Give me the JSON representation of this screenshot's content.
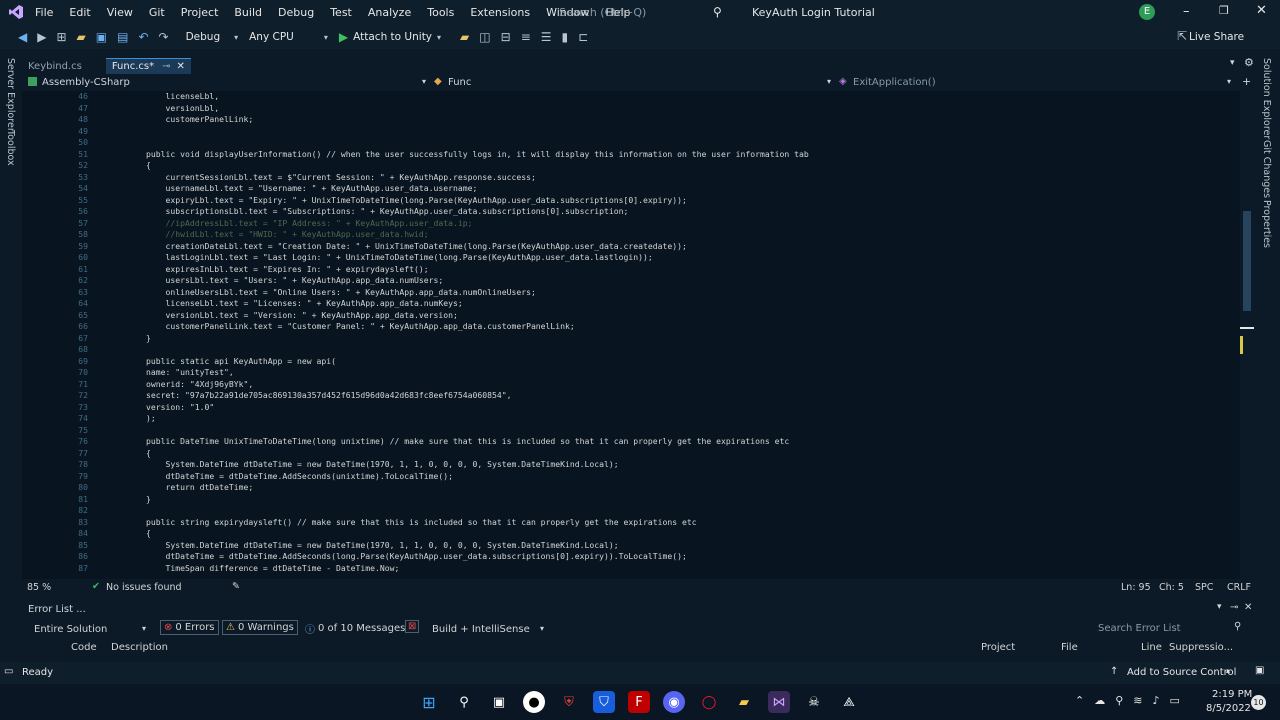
{
  "menu": [
    "File",
    "Edit",
    "View",
    "Git",
    "Project",
    "Build",
    "Debug",
    "Test",
    "Analyze",
    "Tools",
    "Extensions",
    "Window",
    "Help"
  ],
  "search_placeholder": "Search (Ctrl+Q)",
  "window_title": "KeyAuth Login Tutorial",
  "account_initial": "E",
  "toolbar": {
    "config": "Debug",
    "platform": "Any CPU",
    "attach": "Attach to Unity",
    "live_share": "Live Share"
  },
  "tabs": [
    {
      "label": "Keybind.cs"
    },
    {
      "label": "Func.cs*"
    }
  ],
  "nav": {
    "project": "Assembly-CSharp",
    "type": "Func",
    "member": "ExitApplication()"
  },
  "left_side": [
    "Server Explorer",
    "Toolbox"
  ],
  "right_side": [
    "Solution Explorer",
    "Git Changes",
    "Properties"
  ],
  "code_lines": [
    {
      "n": "46",
      "t": "            licenseLbl,"
    },
    {
      "n": "47",
      "t": "            versionLbl,"
    },
    {
      "n": "48",
      "t": "            customerPanelLink;"
    },
    {
      "n": "49",
      "t": ""
    },
    {
      "n": "50",
      "t": ""
    },
    {
      "n": "51",
      "t": "        public void displayUserInformation() // when the user successfully logs in, it will display this information on the user information tab"
    },
    {
      "n": "52",
      "t": "        {"
    },
    {
      "n": "53",
      "t": "            currentSessionLbl.text = $\"Current Session: \" + KeyAuthApp.response.success;"
    },
    {
      "n": "54",
      "t": "            usernameLbl.text = \"Username: \" + KeyAuthApp.user_data.username;"
    },
    {
      "n": "55",
      "t": "            expiryLbl.text = \"Expiry: \" + UnixTimeToDateTime(long.Parse(KeyAuthApp.user_data.subscriptions[0].expiry));"
    },
    {
      "n": "56",
      "t": "            subscriptionsLbl.text = \"Subscriptions: \" + KeyAuthApp.user_data.subscriptions[0].subscription;"
    },
    {
      "n": "57",
      "t": "            //ipAddressLbl.text = \"IP Address: \" + KeyAuthApp.user_data.ip;"
    },
    {
      "n": "58",
      "t": "            //hwidLbl.text = \"HWID: \" + KeyAuthApp.user_data.hwid;"
    },
    {
      "n": "59",
      "t": "            creationDateLbl.text = \"Creation Date: \" + UnixTimeToDateTime(long.Parse(KeyAuthApp.user_data.createdate));"
    },
    {
      "n": "60",
      "t": "            lastLoginLbl.text = \"Last Login: \" + UnixTimeToDateTime(long.Parse(KeyAuthApp.user_data.lastlogin));"
    },
    {
      "n": "61",
      "t": "            expiresInLbl.text = \"Expires In: \" + expirydaysleft();"
    },
    {
      "n": "62",
      "t": "            usersLbl.text = \"Users: \" + KeyAuthApp.app_data.numUsers;"
    },
    {
      "n": "63",
      "t": "            onlineUsersLbl.text = \"Online Users: \" + KeyAuthApp.app_data.numOnlineUsers;"
    },
    {
      "n": "64",
      "t": "            licenseLbl.text = \"Licenses: \" + KeyAuthApp.app_data.numKeys;"
    },
    {
      "n": "65",
      "t": "            versionLbl.text = \"Version: \" + KeyAuthApp.app_data.version;"
    },
    {
      "n": "66",
      "t": "            customerPanelLink.text = \"Customer Panel: \" + KeyAuthApp.app_data.customerPanelLink;"
    },
    {
      "n": "67",
      "t": "        }"
    },
    {
      "n": "68",
      "t": ""
    },
    {
      "n": "69",
      "t": "        public static api KeyAuthApp = new api("
    },
    {
      "n": "70",
      "t": "        name: \"unityTest\","
    },
    {
      "n": "71",
      "t": "        ownerid: \"4Xdj96yBYk\","
    },
    {
      "n": "72",
      "t": "        secret: \"97a7b22a91de705ac869130a357d452f615d96d0a42d683fc8eef6754a060854\","
    },
    {
      "n": "73",
      "t": "        version: \"1.0\""
    },
    {
      "n": "74",
      "t": "        );"
    },
    {
      "n": "75",
      "t": ""
    },
    {
      "n": "76",
      "t": "        public DateTime UnixTimeToDateTime(long unixtime) // make sure that this is included so that it can properly get the expirations etc"
    },
    {
      "n": "77",
      "t": "        {"
    },
    {
      "n": "78",
      "t": "            System.DateTime dtDateTime = new DateTime(1970, 1, 1, 0, 0, 0, 0, System.DateTimeKind.Local);"
    },
    {
      "n": "79",
      "t": "            dtDateTime = dtDateTime.AddSeconds(unixtime).ToLocalTime();"
    },
    {
      "n": "80",
      "t": "            return dtDateTime;"
    },
    {
      "n": "81",
      "t": "        }"
    },
    {
      "n": "82",
      "t": ""
    },
    {
      "n": "83",
      "t": "        public string expirydaysleft() // make sure that this is included so that it can properly get the expirations etc"
    },
    {
      "n": "84",
      "t": "        {"
    },
    {
      "n": "85",
      "t": "            System.DateTime dtDateTime = new DateTime(1970, 1, 1, 0, 0, 0, 0, System.DateTimeKind.Local);"
    },
    {
      "n": "86",
      "t": "            dtDateTime = dtDateTime.AddSeconds(long.Parse(KeyAuthApp.user_data.subscriptions[0].expiry)).ToLocalTime();"
    },
    {
      "n": "87",
      "t": "            TimeSpan difference = dtDateTime - DateTime.Now;"
    }
  ],
  "editor_status": {
    "zoom": "85 %",
    "issues": "No issues found",
    "ln": "Ln: 95",
    "ch": "Ch: 5",
    "spc": "SPC",
    "crlf": "CRLF"
  },
  "error_list": {
    "title": "Error List ...",
    "scope": "Entire Solution",
    "errors": "0 Errors",
    "warnings": "0 Warnings",
    "messages": "0 of 10 Messages",
    "filter": "Build + IntelliSense",
    "search": "Search Error List",
    "cols": [
      "Code",
      "Description",
      "Project",
      "File",
      "Line",
      "Suppressio..."
    ]
  },
  "status": {
    "ready": "Ready",
    "source_control": "Add to Source Control"
  },
  "clock": {
    "time": "2:19 PM",
    "date": "8/5/2022",
    "badge": "10"
  }
}
